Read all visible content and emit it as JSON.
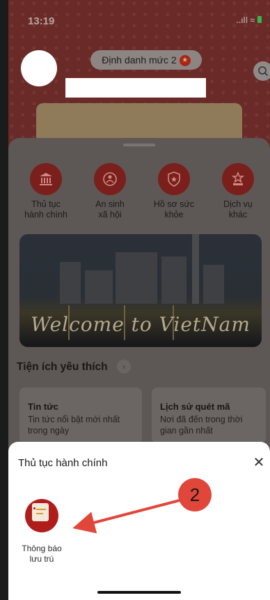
{
  "status_bar": {
    "time": "13:19",
    "indicators": "..ıll ≈"
  },
  "header": {
    "id_level_label": "Định danh mức 2"
  },
  "services": [
    {
      "label": "Thủ tục\nhành chính",
      "icon": "institution-icon"
    },
    {
      "label": "An sinh\nxã hội",
      "icon": "social-security-icon"
    },
    {
      "label": "Hồ sơ sức\nkhỏe",
      "icon": "health-shield-icon"
    },
    {
      "label": "Dịch vụ\nkhác",
      "icon": "other-services-icon"
    }
  ],
  "banner": {
    "text": "Welcome to VietNam"
  },
  "favorites": {
    "title": "Tiện ích yêu thích",
    "cards": [
      {
        "title": "Tin tức",
        "desc": "Tin tức nổi bật mới nhất\ntrong ngày"
      },
      {
        "title": "Lịch sử quét mã",
        "desc": "Nơi đã đến trong thời\ngian gần nhất"
      }
    ]
  },
  "sheet": {
    "title": "Thủ tục hành chính",
    "close_glyph": "✕",
    "items": [
      {
        "label": "Thông báo\nlưu trú",
        "icon": "notification-document-icon"
      }
    ]
  },
  "annotation": {
    "number": "2",
    "color": "#e0473a"
  }
}
